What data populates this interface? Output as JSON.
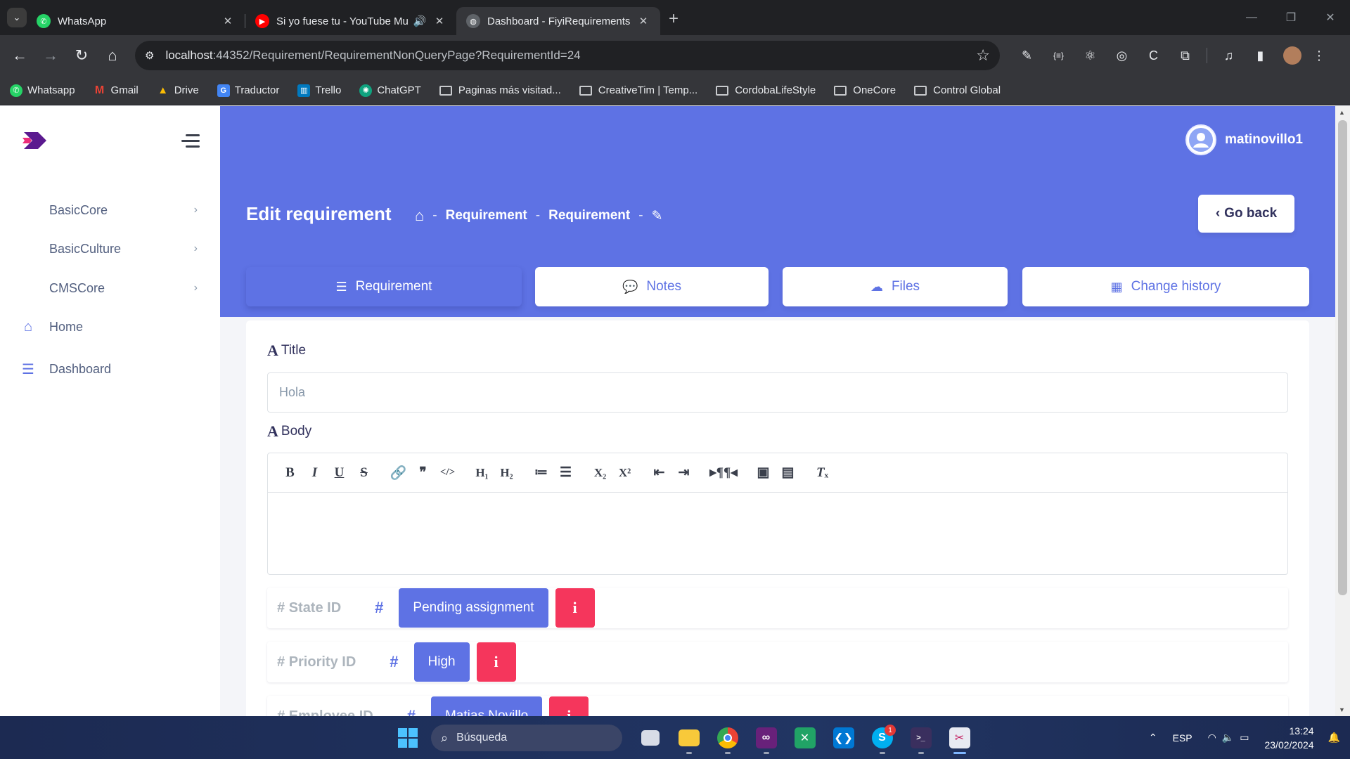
{
  "browser": {
    "tabs": [
      {
        "title": "WhatsApp",
        "icon": "whatsapp-icon",
        "color": "#25d366"
      },
      {
        "title": "Si yo fuese tu - YouTube Mu",
        "icon": "youtube-icon",
        "color": "#ff0000"
      },
      {
        "title": "Dashboard - FiyiRequirements",
        "icon": "globe-icon",
        "color": "#9aa0a6"
      }
    ],
    "url_host": "localhost",
    "url_rest": ":44352/Requirement/RequirementNonQueryPage?RequirementId=24",
    "bookmarks": [
      {
        "label": "Whatsapp",
        "icon": "whatsapp-icon",
        "color": "#25d366"
      },
      {
        "label": "Gmail",
        "icon": "gmail-icon",
        "color": "#ea4335"
      },
      {
        "label": "Drive",
        "icon": "drive-icon",
        "color": "#fbbc04"
      },
      {
        "label": "Traductor",
        "icon": "translate-icon",
        "color": "#4285f4"
      },
      {
        "label": "Trello",
        "icon": "trello-icon",
        "color": "#0079bf"
      },
      {
        "label": "ChatGPT",
        "icon": "chatgpt-icon",
        "color": "#10a37f"
      },
      {
        "label": "Paginas más visitad...",
        "icon": "folder-icon"
      },
      {
        "label": "CreativeTim | Temp...",
        "icon": "folder-icon"
      },
      {
        "label": "CordobaLifeStyle",
        "icon": "folder-icon"
      },
      {
        "label": "OneCore",
        "icon": "folder-icon"
      },
      {
        "label": "Control Global",
        "icon": "folder-icon"
      }
    ]
  },
  "sidebar": {
    "items": [
      {
        "label": "BasicCore",
        "expandable": true
      },
      {
        "label": "BasicCulture",
        "expandable": true
      },
      {
        "label": "CMSCore",
        "expandable": true
      },
      {
        "label": "Home",
        "icon": "home-icon"
      },
      {
        "label": "Dashboard",
        "icon": "list-icon"
      }
    ]
  },
  "header": {
    "username": "matinovillo1",
    "page_title": "Edit requirement",
    "breadcrumb": [
      "Requirement",
      "Requirement"
    ],
    "go_back_label": "Go back"
  },
  "page_tabs": [
    {
      "label": "Requirement",
      "icon": "list-icon",
      "active": true
    },
    {
      "label": "Notes",
      "icon": "comment-icon",
      "active": false
    },
    {
      "label": "Files",
      "icon": "cloud-upload-icon",
      "active": false
    },
    {
      "label": "Change history",
      "icon": "calendar-icon",
      "active": false
    }
  ],
  "form": {
    "title_label": "Title",
    "title_value": "Hola",
    "body_label": "Body",
    "state_label": "State ID",
    "state_value": "Pending assignment",
    "priority_label": "Priority ID",
    "priority_value": "High",
    "employee_label": "Employee ID",
    "employee_value": "Matias Novillo"
  },
  "taskbar": {
    "search_placeholder": "Búsqueda",
    "language": "ESP",
    "time": "13:24",
    "date": "23/02/2024",
    "skype_badge": "1"
  },
  "colors": {
    "primary": "#5e72e4",
    "danger": "#f5365c"
  }
}
